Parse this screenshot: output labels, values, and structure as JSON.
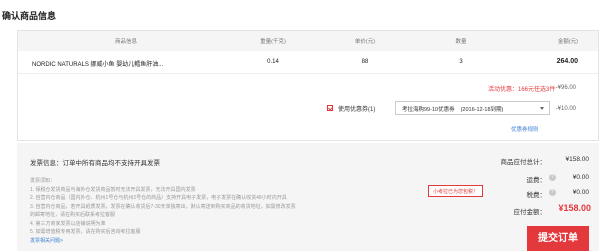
{
  "page_title": "确认商品信息",
  "table": {
    "headers": [
      "商品信息",
      "重量(千克)",
      "单价(元)",
      "数量",
      "金额(元)"
    ],
    "rows": [
      {
        "name": "NORDIC NATURALS 挪威小鱼 婴幼儿鳕鱼肝油...",
        "weight": "0.14",
        "price": "88",
        "qty": "3",
        "amount": "264.00"
      }
    ]
  },
  "promotion": {
    "label": "活动优惠：166元任选3件",
    "discount": "-¥96.00"
  },
  "coupon": {
    "checkbox_label": "使用优惠券(1)",
    "selected_name": "考拉海购99-10优惠券",
    "selected_expiry": "(2016-12-18到期)",
    "discount": "-¥10.00",
    "rules_link": "优惠券规则"
  },
  "invoice": {
    "title": "发票信息：订单中所有商品均不支持开具发票",
    "notes_heading": "发票须知：",
    "notes": [
      "1. 保税仓发货商品与海外仓发货商品暂时无法开具发票，无法开具国内发票",
      "2. 自营内仓商品（国内外仓、杭州1号仓与杭州2号仓的商品）支持开具电子发票，电子发票在确认收货48小时内开具",
      "3. 自营内仓商品，若开具纸质发票，发票在确认收货后7-30天单独寄出，默认寄送到购买商品的收货地址，如需修改发票",
      "的邮寄地址，请在购买后联系考拉客服",
      "4. 第三方商家发票以店铺说明为准",
      "5. 如需增值税专用发票，请在购买后咨询考拉客服"
    ],
    "help_link": "发票相关问题>"
  },
  "summary": {
    "subtotal_label": "商品应付总计：",
    "subtotal_value": "¥158.00",
    "shipping_label": "运费：",
    "shipping_value": "¥0.00",
    "tax_label": "税费：",
    "tax_value": "¥0.00",
    "tax_tip": "小考拉已为您包税！",
    "total_label": "应付金额：",
    "total_value": "¥158.00",
    "help_icon_glyph": "?"
  },
  "submit_label": "提交订单",
  "colors": {
    "accent": "#e4393c",
    "link": "#3a7fd5"
  }
}
